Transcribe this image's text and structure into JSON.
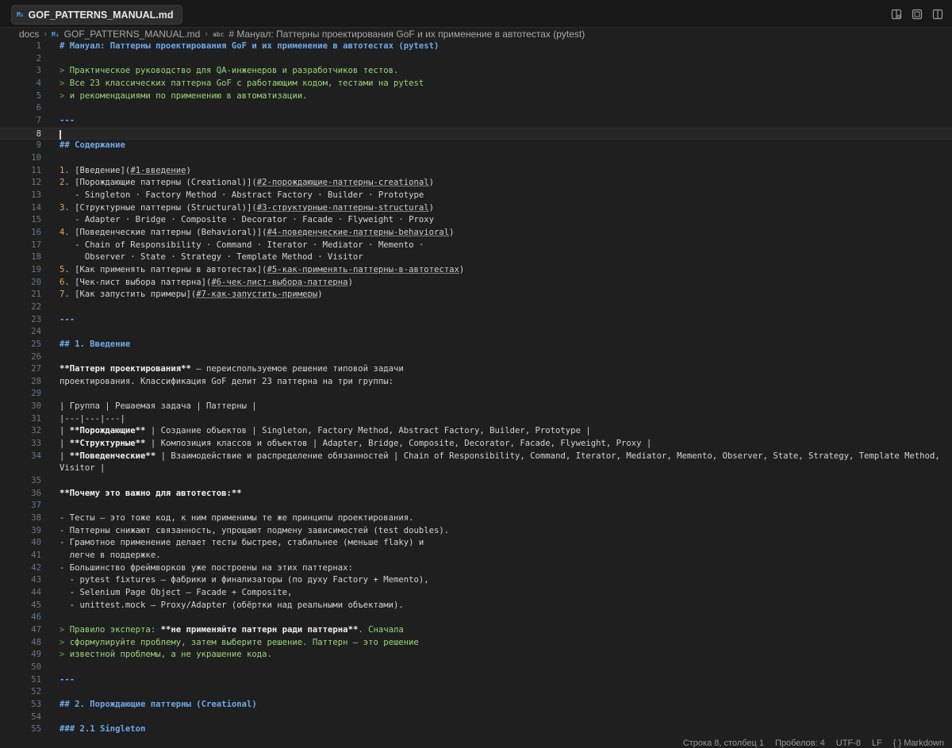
{
  "tab": {
    "icon": "markdown-icon",
    "title": "GOF_PATTERNS_MANUAL.md"
  },
  "breadcrumb": {
    "folder": "docs",
    "file": "GOF_PATTERNS_MANUAL.md",
    "symbol": "# Мануал: Паттерны проектирования GoF и их применение в автотестах (pytest)"
  },
  "editor": {
    "active_line": 8,
    "lines": [
      {
        "n": "1",
        "segs": [
          {
            "c": "h",
            "t": "# Мануал: Паттерны проектирования GoF и их применение в автотестах (pytest)"
          }
        ]
      },
      {
        "n": "2",
        "segs": []
      },
      {
        "n": "3",
        "segs": [
          {
            "c": "qm",
            "t": "> "
          },
          {
            "c": "q",
            "t": "Практическое руководство для QA-инженеров и разработчиков тестов."
          }
        ]
      },
      {
        "n": "4",
        "segs": [
          {
            "c": "qm",
            "t": "> "
          },
          {
            "c": "q",
            "t": "Все 23 классических паттерна GoF с работающим кодом, тестами на pytest"
          }
        ]
      },
      {
        "n": "5",
        "segs": [
          {
            "c": "qm",
            "t": "> "
          },
          {
            "c": "q",
            "t": "и рекомендациями по применению в автоматизации."
          }
        ]
      },
      {
        "n": "6",
        "segs": []
      },
      {
        "n": "7",
        "segs": [
          {
            "c": "hr",
            "t": "---"
          }
        ]
      },
      {
        "n": "8",
        "segs": []
      },
      {
        "n": "9",
        "segs": [
          {
            "c": "h",
            "t": "## Содержание"
          }
        ]
      },
      {
        "n": "10",
        "segs": []
      },
      {
        "n": "11",
        "segs": [
          {
            "c": "num",
            "t": "1. "
          },
          {
            "c": "lnk",
            "t": "[Введение]("
          },
          {
            "c": "url",
            "t": "#1-введение"
          },
          {
            "c": "lnk",
            "t": ")"
          }
        ]
      },
      {
        "n": "12",
        "segs": [
          {
            "c": "num",
            "t": "2. "
          },
          {
            "c": "lnk",
            "t": "[Порождающие паттерны (Creational)]("
          },
          {
            "c": "url",
            "t": "#2-порождающие-паттерны-creational"
          },
          {
            "c": "lnk",
            "t": ")"
          }
        ]
      },
      {
        "n": "13",
        "segs": [
          {
            "c": "guide",
            "t": "   "
          },
          {
            "c": "txt",
            "t": "- Singleton · Factory Method · Abstract Factory · Builder · Prototype"
          }
        ]
      },
      {
        "n": "14",
        "segs": [
          {
            "c": "num",
            "t": "3. "
          },
          {
            "c": "lnk",
            "t": "[Структурные паттерны (Structural)]("
          },
          {
            "c": "url",
            "t": "#3-структурные-паттерны-structural"
          },
          {
            "c": "lnk",
            "t": ")"
          }
        ]
      },
      {
        "n": "15",
        "segs": [
          {
            "c": "guide",
            "t": "   "
          },
          {
            "c": "txt",
            "t": "- Adapter · Bridge · Composite · Decorator · Facade · Flyweight · Proxy"
          }
        ]
      },
      {
        "n": "16",
        "segs": [
          {
            "c": "num",
            "t": "4. "
          },
          {
            "c": "lnk",
            "t": "[Поведенческие паттерны (Behavioral)]("
          },
          {
            "c": "url",
            "t": "#4-поведенческие-паттерны-behavioral"
          },
          {
            "c": "lnk",
            "t": ")"
          }
        ]
      },
      {
        "n": "17",
        "segs": [
          {
            "c": "guide",
            "t": "   "
          },
          {
            "c": "txt",
            "t": "- Chain of Responsibility · Command · Iterator · Mediator · Memento ·"
          }
        ]
      },
      {
        "n": "18",
        "segs": [
          {
            "c": "guide",
            "t": "     "
          },
          {
            "c": "txt",
            "t": "Observer · State · Strategy · Template Method · Visitor"
          }
        ]
      },
      {
        "n": "19",
        "segs": [
          {
            "c": "num",
            "t": "5. "
          },
          {
            "c": "lnk",
            "t": "[Как применять паттерны в автотестах]("
          },
          {
            "c": "url",
            "t": "#5-как-применять-паттерны-в-автотестах"
          },
          {
            "c": "lnk",
            "t": ")"
          }
        ]
      },
      {
        "n": "20",
        "segs": [
          {
            "c": "num",
            "t": "6. "
          },
          {
            "c": "lnk",
            "t": "[Чек-лист выбора паттерна]("
          },
          {
            "c": "url",
            "t": "#6-чек-лист-выбора-паттерна"
          },
          {
            "c": "lnk",
            "t": ")"
          }
        ]
      },
      {
        "n": "21",
        "segs": [
          {
            "c": "num",
            "t": "7. "
          },
          {
            "c": "lnk",
            "t": "[Как запустить примеры]("
          },
          {
            "c": "url",
            "t": "#7-как-запустить-примеры"
          },
          {
            "c": "lnk",
            "t": ")"
          }
        ]
      },
      {
        "n": "22",
        "segs": []
      },
      {
        "n": "23",
        "segs": [
          {
            "c": "hr",
            "t": "---"
          }
        ]
      },
      {
        "n": "24",
        "segs": []
      },
      {
        "n": "25",
        "segs": [
          {
            "c": "h",
            "t": "## 1. Введение"
          }
        ]
      },
      {
        "n": "26",
        "segs": []
      },
      {
        "n": "27",
        "segs": [
          {
            "c": "b",
            "t": "**Паттерн проектирования**"
          },
          {
            "c": "txt",
            "t": " — переиспользуемое решение типовой задачи"
          }
        ]
      },
      {
        "n": "28",
        "segs": [
          {
            "c": "txt",
            "t": "проектирования. Классификация GoF делит 23 паттерна на три группы:"
          }
        ]
      },
      {
        "n": "29",
        "segs": []
      },
      {
        "n": "30",
        "segs": [
          {
            "c": "txt",
            "t": "| Группа | Решаемая задача | Паттерны |"
          }
        ]
      },
      {
        "n": "31",
        "segs": [
          {
            "c": "txt",
            "t": "|---|---|---|"
          }
        ]
      },
      {
        "n": "32",
        "segs": [
          {
            "c": "txt",
            "t": "| "
          },
          {
            "c": "b",
            "t": "**Порождающие**"
          },
          {
            "c": "txt",
            "t": " | Создание объектов | Singleton, Factory Method, Abstract Factory, Builder, Prototype |"
          }
        ]
      },
      {
        "n": "33",
        "segs": [
          {
            "c": "txt",
            "t": "| "
          },
          {
            "c": "b",
            "t": "**Структурные**"
          },
          {
            "c": "txt",
            "t": " | Композиция классов и объектов | Adapter, Bridge, Composite, Decorator, Facade, Flyweight, Proxy |"
          }
        ]
      },
      {
        "n": "34",
        "segs": [
          {
            "c": "txt",
            "t": "| "
          },
          {
            "c": "b",
            "t": "**Поведенческие**"
          },
          {
            "c": "txt",
            "t": " | Взаимодействие и распределение обязанностей | Chain of Responsibility, Command, Iterator, Mediator, Memento, Observer, State, Strategy, Template Method,"
          }
        ]
      },
      {
        "n": "",
        "segs": [
          {
            "c": "txt",
            "t": "Visitor |"
          }
        ]
      },
      {
        "n": "35",
        "segs": []
      },
      {
        "n": "36",
        "segs": [
          {
            "c": "b",
            "t": "**Почему это важно для автотестов:**"
          }
        ]
      },
      {
        "n": "37",
        "segs": []
      },
      {
        "n": "38",
        "segs": [
          {
            "c": "txt",
            "t": "- Тесты — это тоже код, к ним применимы те же принципы проектирования."
          }
        ]
      },
      {
        "n": "39",
        "segs": [
          {
            "c": "txt",
            "t": "- Паттерны снижают связанность, упрощают подмену зависимостей (test doubles)."
          }
        ]
      },
      {
        "n": "40",
        "segs": [
          {
            "c": "txt",
            "t": "- Грамотное применение делает тесты быстрее, стабильнее (меньше flaky) и"
          }
        ]
      },
      {
        "n": "41",
        "segs": [
          {
            "c": "guide",
            "t": "  "
          },
          {
            "c": "txt",
            "t": "легче в поддержке."
          }
        ]
      },
      {
        "n": "42",
        "segs": [
          {
            "c": "txt",
            "t": "- Большинство фреймворков уже построены на этих паттернах:"
          }
        ]
      },
      {
        "n": "43",
        "segs": [
          {
            "c": "guide",
            "t": "  "
          },
          {
            "c": "txt",
            "t": "- pytest fixtures — фабрики и финализаторы (по духу Factory + Memento),"
          }
        ]
      },
      {
        "n": "44",
        "segs": [
          {
            "c": "guide",
            "t": "  "
          },
          {
            "c": "txt",
            "t": "- Selenium Page Object — Facade + Composite,"
          }
        ]
      },
      {
        "n": "45",
        "segs": [
          {
            "c": "guide",
            "t": "  "
          },
          {
            "c": "txt",
            "t": "- unittest.mock — Proxy/Adapter (обёртки над реальными объектами)."
          }
        ]
      },
      {
        "n": "46",
        "segs": []
      },
      {
        "n": "47",
        "segs": [
          {
            "c": "qm",
            "t": "> "
          },
          {
            "c": "q",
            "t": "Правило эксперта: "
          },
          {
            "c": "b",
            "t": "**не применяйте паттерн ради паттерна**"
          },
          {
            "c": "q",
            "t": ". Сначала"
          }
        ]
      },
      {
        "n": "48",
        "segs": [
          {
            "c": "qm",
            "t": "> "
          },
          {
            "c": "q",
            "t": "сформулируйте проблему, затем выберите решение. Паттерн — это решение"
          }
        ]
      },
      {
        "n": "49",
        "segs": [
          {
            "c": "qm",
            "t": "> "
          },
          {
            "c": "q",
            "t": "известной проблемы, а не украшение кода."
          }
        ]
      },
      {
        "n": "50",
        "segs": []
      },
      {
        "n": "51",
        "segs": [
          {
            "c": "hr",
            "t": "---"
          }
        ]
      },
      {
        "n": "52",
        "segs": []
      },
      {
        "n": "53",
        "segs": [
          {
            "c": "h",
            "t": "## 2. Порождающие паттерны (Creational)"
          }
        ]
      },
      {
        "n": "54",
        "segs": []
      },
      {
        "n": "55",
        "segs": [
          {
            "c": "h",
            "t": "### 2.1 Singleton"
          }
        ]
      }
    ]
  },
  "statusbar": {
    "position": "Строка 8, столбец 1",
    "spaces": "Пробелов: 4",
    "encoding": "UTF-8",
    "eol": "LF",
    "language": "{ } Markdown"
  }
}
